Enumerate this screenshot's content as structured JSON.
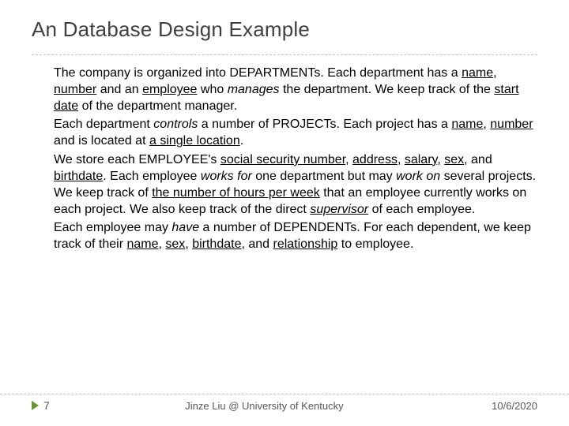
{
  "title": "An Database Design Example",
  "bullets": [
    {
      "segments": [
        {
          "t": "The company is organized into DEPARTMENTs. Each department has a "
        },
        {
          "t": "name",
          "u": true
        },
        {
          "t": ", "
        },
        {
          "t": "number",
          "u": true
        },
        {
          "t": " and an "
        },
        {
          "t": "employee",
          "u": true
        },
        {
          "t": " who "
        },
        {
          "t": "manages",
          "i": true
        },
        {
          "t": " the department. We keep track of the "
        },
        {
          "t": "start date",
          "u": true
        },
        {
          "t": " of the department manager."
        }
      ]
    },
    {
      "segments": [
        {
          "t": "Each department "
        },
        {
          "t": "controls",
          "i": true
        },
        {
          "t": " a number of PROJECTs. Each project has a "
        },
        {
          "t": "name",
          "u": true
        },
        {
          "t": ", "
        },
        {
          "t": "number ",
          "u": true
        },
        {
          "t": "and is located at "
        },
        {
          "t": "a single location",
          "u": true
        },
        {
          "t": "."
        }
      ]
    },
    {
      "segments": [
        {
          "t": "We store each EMPLOYEE's "
        },
        {
          "t": "social security number",
          "u": true
        },
        {
          "t": ", "
        },
        {
          "t": "address",
          "u": true
        },
        {
          "t": ", "
        },
        {
          "t": "salary",
          "u": true
        },
        {
          "t": ", "
        },
        {
          "t": "sex",
          "u": true
        },
        {
          "t": ", and "
        },
        {
          "t": "birthdate",
          "u": true
        },
        {
          "t": ". Each employee "
        },
        {
          "t": "works for",
          "i": true
        },
        {
          "t": " one department but may "
        },
        {
          "t": "work on",
          "i": true
        },
        {
          "t": " several projects. We keep track of "
        },
        {
          "t": "the number of hours per week",
          "u": true
        },
        {
          "t": " that an employee currently works on each project. We also keep track of the direct "
        },
        {
          "t": "supervisor",
          "u": true,
          "i": true
        },
        {
          "t": " of each employee."
        }
      ]
    },
    {
      "segments": [
        {
          "t": "Each employee may "
        },
        {
          "t": "have",
          "i": true
        },
        {
          "t": " a number of DEPENDENTs. For each dependent, we keep track of their "
        },
        {
          "t": "name",
          "u": true
        },
        {
          "t": ", "
        },
        {
          "t": "sex",
          "u": true
        },
        {
          "t": ", "
        },
        {
          "t": "birthdate",
          "u": true
        },
        {
          "t": ", and "
        },
        {
          "t": "relationship",
          "u": true
        },
        {
          "t": " to employee."
        }
      ]
    }
  ],
  "footer": {
    "page": "7",
    "center": "Jinze Liu @ University of Kentucky",
    "date": "10/6/2020"
  },
  "bullet_glyph": ""
}
